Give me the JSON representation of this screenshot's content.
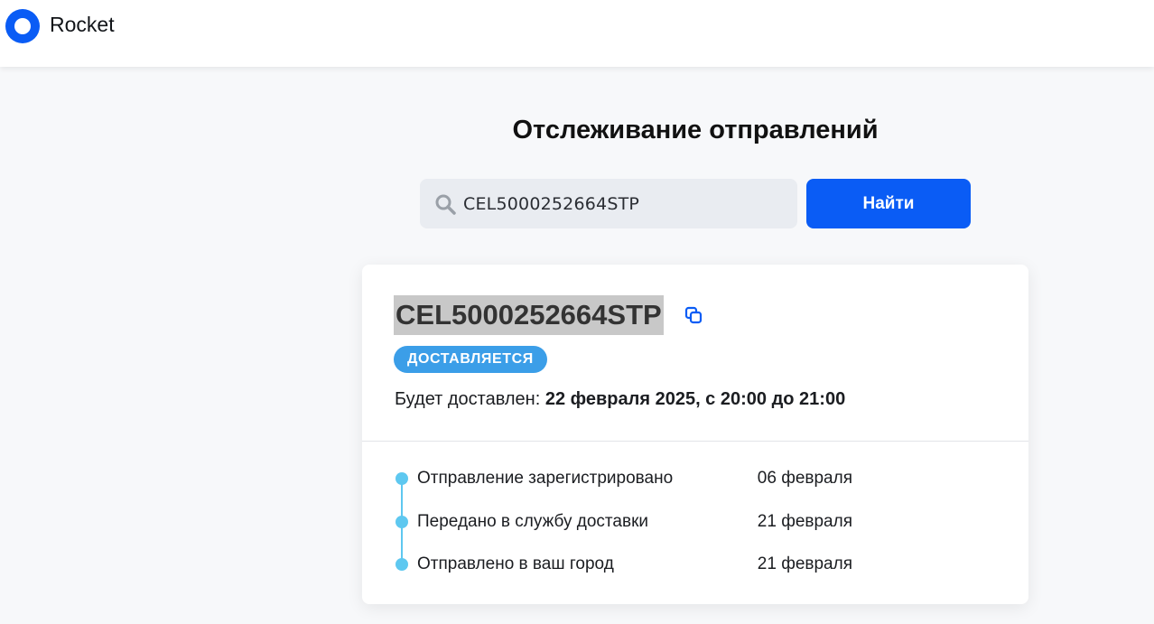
{
  "header": {
    "brand": "Rocket",
    "logo_color": "#0a5cf5"
  },
  "page": {
    "title": "Отслеживание отправлений"
  },
  "search": {
    "value": "CEL5000252664STP",
    "icon": "search-icon",
    "button_label": "Найти",
    "button_color": "#0a5cf5"
  },
  "shipment": {
    "tracking_number": "CEL5000252664STP",
    "copy_icon": "copy-icon",
    "status": "ДОСТАВЛЯЕТСЯ",
    "status_color": "#3b9ee8",
    "delivery_label": "Будет доставлен:",
    "delivery_value": "22 февраля 2025, с 20:00 до 21:00"
  },
  "timeline": {
    "accent_color": "#5ec8f0",
    "events": [
      {
        "label": "Отправление зарегистрировано",
        "date": "06 февраля"
      },
      {
        "label": "Передано в службу доставки",
        "date": "21 февраля"
      },
      {
        "label": "Отправлено в ваш город",
        "date": "21 февраля"
      }
    ]
  }
}
